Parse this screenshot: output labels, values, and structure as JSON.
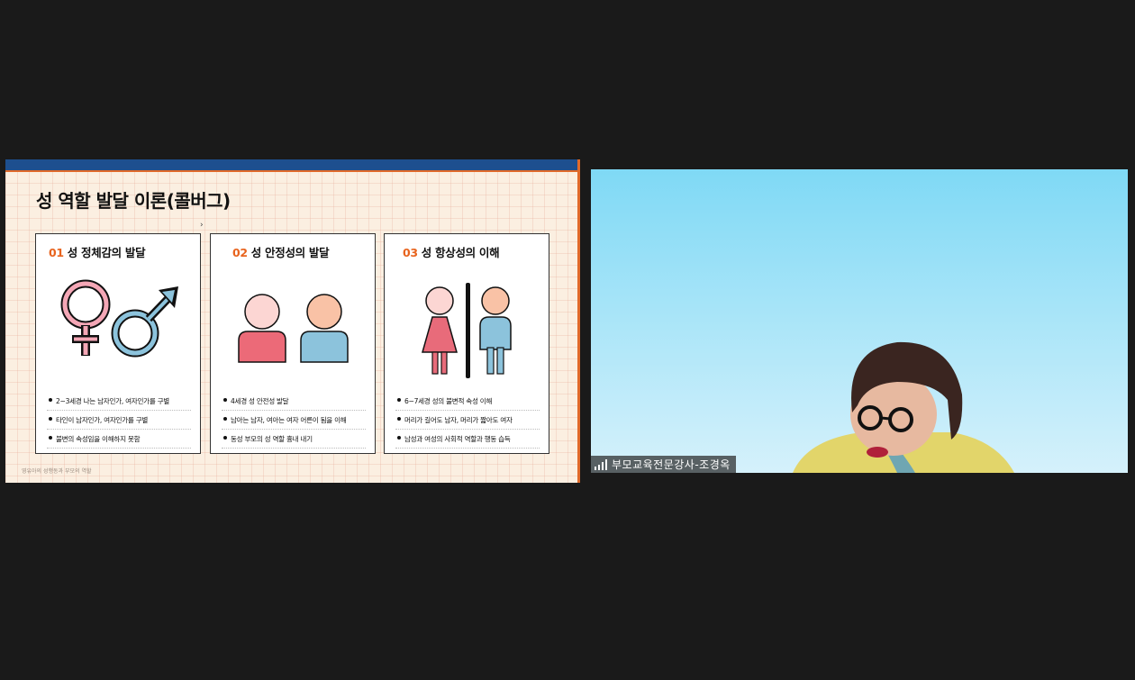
{
  "slide": {
    "title": "성 역할 발달 이론(콜버그)",
    "cursor": "›",
    "footer": "영유아의 성행동과 부모의 역할",
    "cards": [
      {
        "num": "01",
        "heading": "성 정체감의 발달",
        "icon": "gender-symbols-icon",
        "bullets": [
          "2~3세경 나는 남자인가, 여자인가를 구별",
          "타인이 남자인가, 여자인가를 구별",
          "불변의 속성임을 이해하지 못함"
        ]
      },
      {
        "num": "02",
        "heading": "성 안정성의 발달",
        "icon": "two-people-icon",
        "bullets": [
          "4세경 성 안전성 발달",
          "남아는 남자, 여아는 여자 어른이 됨을 이해",
          "동성 부모의 성 역할 흉내 내기"
        ]
      },
      {
        "num": "03",
        "heading": "성 항상성의 이해",
        "icon": "restroom-figures-icon",
        "bullets": [
          "6~7세경 성의 불변적 속성 이해",
          "머리가 길어도 남자, 머리가 짧아도 여자",
          "남성과 여성의 사회적 역할과 행동 습득"
        ]
      }
    ]
  },
  "video": {
    "participant_name": "부모교육전문강사-조경옥",
    "signal_icon": "signal-bars-icon"
  },
  "colors": {
    "background": "#1a1a1a",
    "slide_accent_blue": "#1d4f8f",
    "slide_accent_orange": "#e8641e",
    "female_pink": "#e86b7a",
    "male_blue": "#8cc3dc"
  }
}
